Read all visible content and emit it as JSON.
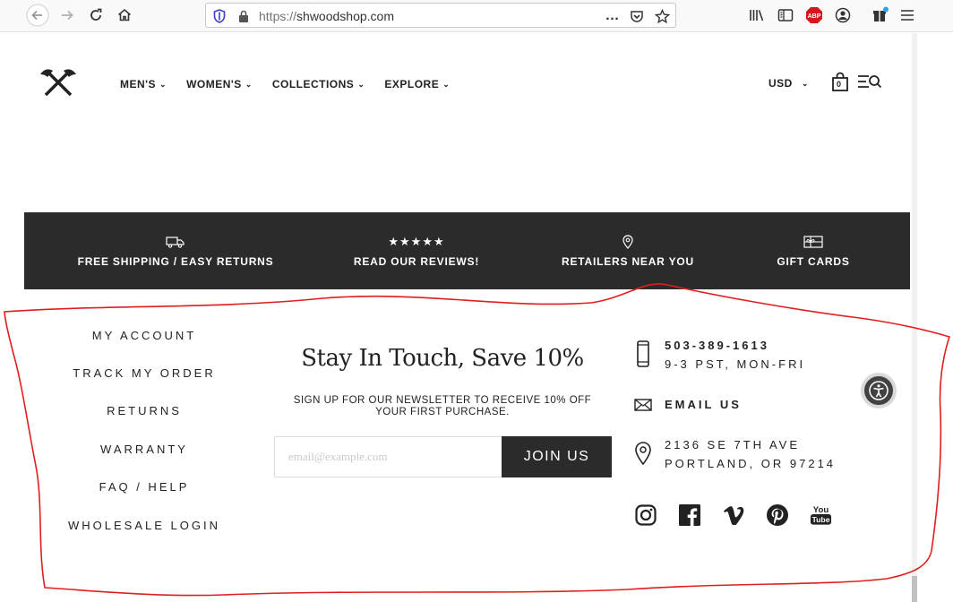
{
  "browser": {
    "url_scheme": "https://",
    "url_host": "shwoodshop.com",
    "more_icon": "…"
  },
  "header": {
    "nav": [
      {
        "label": "MEN'S"
      },
      {
        "label": "WOMEN'S"
      },
      {
        "label": "COLLECTIONS"
      },
      {
        "label": "EXPLORE"
      }
    ],
    "currency": "USD",
    "cart_count": "0"
  },
  "features": [
    {
      "label": "FREE SHIPPING / EASY RETURNS",
      "icon": "truck-icon"
    },
    {
      "label": "READ OUR REVIEWS!",
      "icon": "five-stars-icon"
    },
    {
      "label": "RETAILERS NEAR YOU",
      "icon": "map-pin-icon"
    },
    {
      "label": "GIFT CARDS",
      "icon": "gift-card-icon"
    }
  ],
  "footer": {
    "links": [
      {
        "label": "MY ACCOUNT"
      },
      {
        "label": "TRACK MY ORDER"
      },
      {
        "label": "RETURNS"
      },
      {
        "label": "WARRANTY"
      },
      {
        "label": "FAQ / HELP"
      },
      {
        "label": "WHOLESALE LOGIN"
      }
    ],
    "newsletter": {
      "title": "Stay In Touch, Save 10%",
      "subtitle_line1": "SIGN UP FOR OUR NEWSLETTER TO RECEIVE 10% OFF",
      "subtitle_line2": "YOUR FIRST PURCHASE.",
      "placeholder": "email@example.com",
      "button": "JOIN US"
    },
    "contact": {
      "phone": "503-389-1613",
      "hours": "9-3 PST, MON-FRI",
      "email_label": "EMAIL US",
      "address_line1": "2136 SE 7TH AVE",
      "address_line2": "PORTLAND, OR 97214"
    },
    "socials": [
      "instagram-icon",
      "facebook-icon",
      "vimeo-icon",
      "pinterest-icon",
      "youtube-icon"
    ],
    "youtube_text_top": "You",
    "youtube_text_bottom": "Tube"
  },
  "colors": {
    "band": "#2b2b2b",
    "annotation": "#e01e1e",
    "abp_badge": "#d4171d"
  }
}
